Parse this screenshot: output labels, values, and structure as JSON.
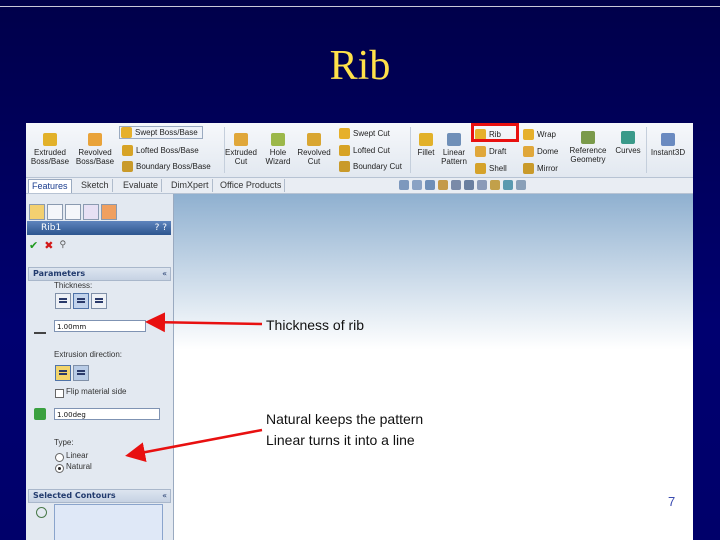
{
  "slide": {
    "title": "Rib",
    "number": "7"
  },
  "ribbon": {
    "commands_large": [
      {
        "label": "Extruded\nBoss/Base",
        "icon": "extruded-boss-icon"
      },
      {
        "label": "Revolved\nBoss/Base",
        "icon": "revolved-boss-icon"
      },
      {
        "label": "Extruded\nCut",
        "icon": "extruded-cut-icon"
      },
      {
        "label": "Hole\nWizard",
        "icon": "hole-wizard-icon"
      },
      {
        "label": "Revolved\nCut",
        "icon": "revolved-cut-icon"
      },
      {
        "label": "Fillet",
        "icon": "fillet-icon"
      },
      {
        "label": "Linear\nPattern",
        "icon": "linear-pattern-icon"
      },
      {
        "label": "Reference\nGeometry",
        "icon": "reference-geometry-icon"
      },
      {
        "label": "Curves",
        "icon": "curves-icon"
      },
      {
        "label": "Instant3D",
        "icon": "instant3d-icon"
      }
    ],
    "boss_stack": [
      "Swept Boss/Base",
      "Lofted Boss/Base",
      "Boundary Boss/Base"
    ],
    "cut_stack": [
      "Swept Cut",
      "Lofted Cut",
      "Boundary Cut"
    ],
    "feature_col1": [
      "Rib",
      "Draft",
      "Shell"
    ],
    "feature_col2": [
      "Wrap",
      "Dome",
      "Mirror"
    ]
  },
  "tabs": [
    "Features",
    "Sketch",
    "Evaluate",
    "DimXpert",
    "Office Products"
  ],
  "property_manager": {
    "feature_name": "Rib1",
    "help": "? ?",
    "parameters_header": "Parameters",
    "thickness_label": "Thickness:",
    "thickness_value": "1.00mm",
    "extrusion_label": "Extrusion direction:",
    "flip_label": "Flip material side",
    "draft_value": "1.00deg",
    "type_label": "Type:",
    "type_options": [
      "Linear",
      "Natural"
    ],
    "selected_type": "Natural",
    "contours_header": "Selected Contours"
  },
  "annotations": {
    "thickness": "Thickness of rib",
    "natural": "Natural keeps the pattern",
    "linear": "Linear turns it into a line"
  },
  "colors": {
    "title": "#ffe14a",
    "arrow": "#e81010",
    "background": "#000060"
  }
}
